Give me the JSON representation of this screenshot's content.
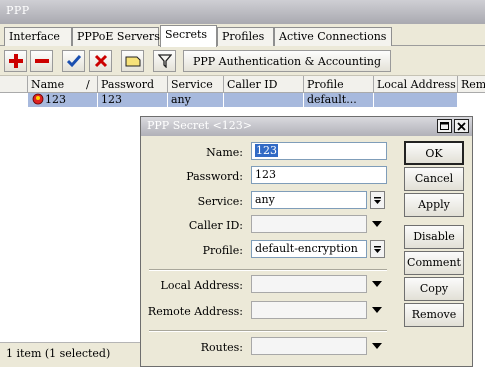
{
  "window": {
    "title": "PPP"
  },
  "tabs": [
    "Interface",
    "PPPoE Servers",
    "Secrets",
    "Profiles",
    "Active Connections"
  ],
  "toolbar": {
    "add_icon": "plus-icon",
    "remove_icon": "minus-icon",
    "enable_icon": "check-icon",
    "disable_icon": "x-icon",
    "comment_icon": "comment-icon",
    "filter_icon": "filter-icon",
    "auth_button": "PPP Authentication & Accounting"
  },
  "table": {
    "columns": [
      "Name",
      "/",
      "Password",
      "Service",
      "Caller ID",
      "Profile",
      "Local Address",
      "Remo"
    ],
    "rows": [
      {
        "name": "123",
        "password": "123",
        "service": "any",
        "caller_id": "",
        "profile": "default...",
        "local_address": ""
      }
    ]
  },
  "status": {
    "text": "1 item (1 selected)"
  },
  "dialog": {
    "title": "PPP Secret <123>",
    "name_label": "Name:",
    "name_value": "123",
    "password_label": "Password:",
    "password_value": "123",
    "service_label": "Service:",
    "service_value": "any",
    "caller_id_label": "Caller ID:",
    "caller_id_value": "",
    "profile_label": "Profile:",
    "profile_value": "default-encryption",
    "local_address_label": "Local Address:",
    "local_address_value": "",
    "remote_address_label": "Remote Address:",
    "remote_address_value": "",
    "routes_label": "Routes:",
    "routes_value": "",
    "buttons": {
      "ok": "OK",
      "cancel": "Cancel",
      "apply": "Apply",
      "disable": "Disable",
      "comment": "Comment",
      "copy": "Copy",
      "remove": "Remove"
    }
  },
  "colors": {
    "selection": "#a7b9dd",
    "accent_add": "#cc0000",
    "accent_check": "#1a4fb0",
    "title_bar": "#b1b1b8"
  }
}
